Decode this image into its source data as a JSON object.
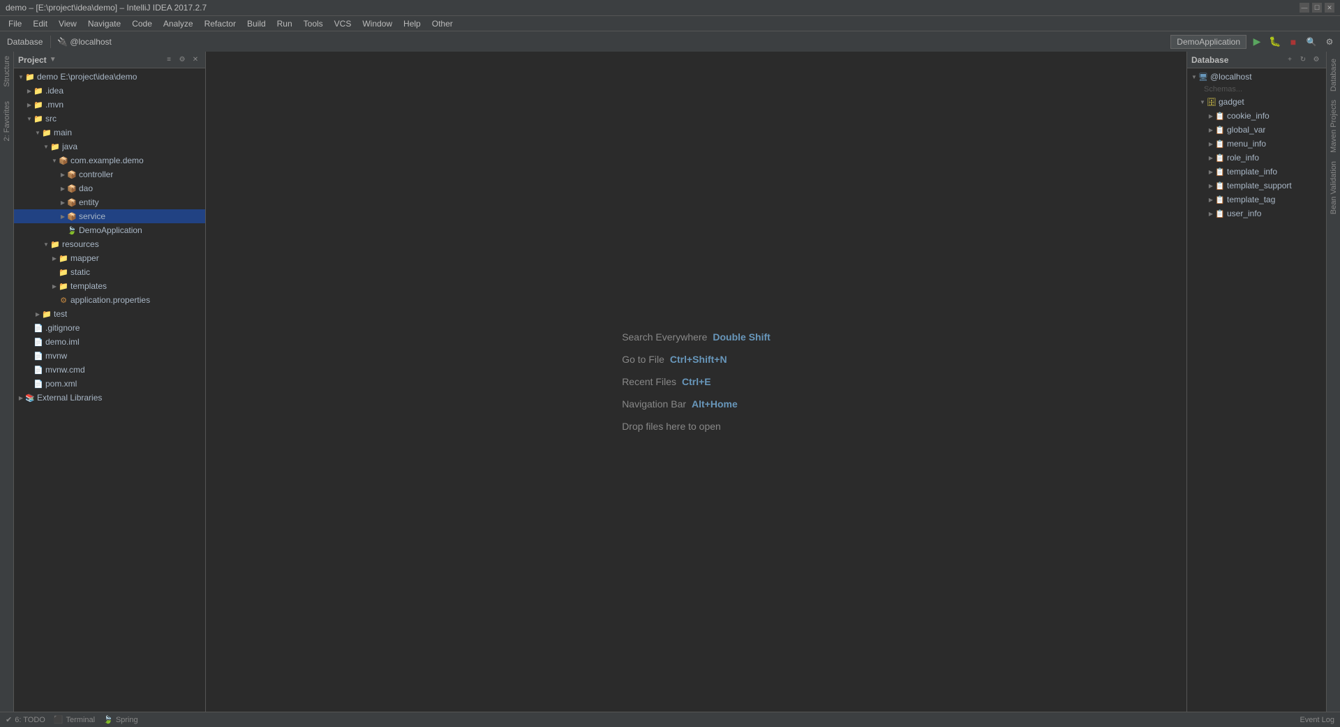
{
  "titleBar": {
    "title": "demo – [E:\\project\\idea\\demo] – IntelliJ IDEA 2017.2.7",
    "minimize": "—",
    "maximize": "☐",
    "close": "✕"
  },
  "menuBar": {
    "items": [
      "File",
      "Edit",
      "View",
      "Navigate",
      "Code",
      "Analyze",
      "Refactor",
      "Build",
      "Run",
      "Tools",
      "VCS",
      "Window",
      "Help",
      "Other"
    ]
  },
  "toolbar": {
    "dbLabel": "Database",
    "localhostLabel": "@localhost",
    "runConfig": "DemoApplication"
  },
  "projectPanel": {
    "title": "Project",
    "tree": [
      {
        "id": "demo",
        "label": "demo E:\\project\\idea\\demo",
        "indent": 1,
        "arrow": "▼",
        "iconType": "folder",
        "expanded": true
      },
      {
        "id": "idea",
        "label": ".idea",
        "indent": 2,
        "arrow": "▶",
        "iconType": "folder",
        "expanded": false
      },
      {
        "id": "mvn",
        "label": ".mvn",
        "indent": 2,
        "arrow": "▶",
        "iconType": "folder",
        "expanded": false
      },
      {
        "id": "src",
        "label": "src",
        "indent": 2,
        "arrow": "▼",
        "iconType": "folder-src",
        "expanded": true
      },
      {
        "id": "main",
        "label": "main",
        "indent": 3,
        "arrow": "▼",
        "iconType": "folder",
        "expanded": true
      },
      {
        "id": "java",
        "label": "java",
        "indent": 4,
        "arrow": "▼",
        "iconType": "folder-java",
        "expanded": true
      },
      {
        "id": "comexampledemo",
        "label": "com.example.demo",
        "indent": 5,
        "arrow": "▼",
        "iconType": "package",
        "expanded": true
      },
      {
        "id": "controller",
        "label": "controller",
        "indent": 6,
        "arrow": "▶",
        "iconType": "package",
        "expanded": false
      },
      {
        "id": "dao",
        "label": "dao",
        "indent": 6,
        "arrow": "▶",
        "iconType": "package",
        "expanded": false
      },
      {
        "id": "entity",
        "label": "entity",
        "indent": 6,
        "arrow": "▶",
        "iconType": "package",
        "expanded": false
      },
      {
        "id": "service",
        "label": "service",
        "indent": 6,
        "arrow": "▶",
        "iconType": "package",
        "expanded": false,
        "selected": true
      },
      {
        "id": "DemoApplication",
        "label": "DemoApplication",
        "indent": 6,
        "arrow": "",
        "iconType": "spring",
        "expanded": false
      },
      {
        "id": "resources",
        "label": "resources",
        "indent": 4,
        "arrow": "▼",
        "iconType": "folder",
        "expanded": true
      },
      {
        "id": "mapper",
        "label": "mapper",
        "indent": 5,
        "arrow": "▶",
        "iconType": "folder",
        "expanded": false
      },
      {
        "id": "static",
        "label": "static",
        "indent": 5,
        "arrow": "",
        "iconType": "folder",
        "expanded": false
      },
      {
        "id": "templates",
        "label": "templates",
        "indent": 5,
        "arrow": "▶",
        "iconType": "folder",
        "expanded": false
      },
      {
        "id": "appprops",
        "label": "application.properties",
        "indent": 5,
        "arrow": "",
        "iconType": "properties",
        "expanded": false
      },
      {
        "id": "test",
        "label": "test",
        "indent": 3,
        "arrow": "▶",
        "iconType": "folder",
        "expanded": false
      },
      {
        "id": "gitignore",
        "label": ".gitignore",
        "indent": 2,
        "arrow": "",
        "iconType": "git",
        "expanded": false
      },
      {
        "id": "demoiml",
        "label": "demo.iml",
        "indent": 2,
        "arrow": "",
        "iconType": "xml",
        "expanded": false
      },
      {
        "id": "mvnw",
        "label": "mvnw",
        "indent": 2,
        "arrow": "",
        "iconType": "file",
        "expanded": false
      },
      {
        "id": "mvnwcmd",
        "label": "mvnw.cmd",
        "indent": 2,
        "arrow": "",
        "iconType": "file",
        "expanded": false
      },
      {
        "id": "pomxml",
        "label": "pom.xml",
        "indent": 2,
        "arrow": "",
        "iconType": "xml",
        "expanded": false
      },
      {
        "id": "extlibs",
        "label": "External Libraries",
        "indent": 1,
        "arrow": "▶",
        "iconType": "lib",
        "expanded": false
      }
    ]
  },
  "centerArea": {
    "shortcuts": [
      {
        "label": "Search Everywhere",
        "key": "Double Shift"
      },
      {
        "label": "Go to File",
        "key": "Ctrl+Shift+N"
      },
      {
        "label": "Recent Files",
        "key": "Ctrl+E"
      },
      {
        "label": "Navigation Bar",
        "key": "Alt+Home"
      }
    ],
    "dropLabel": "Drop files here to open"
  },
  "databasePanel": {
    "title": "Database",
    "schemasLabel": "Schemas...",
    "tree": [
      {
        "id": "localhost",
        "label": "@localhost",
        "indent": 1,
        "arrow": "▼",
        "expanded": true
      },
      {
        "id": "gadget",
        "label": "gadget",
        "indent": 2,
        "arrow": "▼",
        "expanded": true
      },
      {
        "id": "cookie_info",
        "label": "cookie_info",
        "indent": 3,
        "arrow": "▶",
        "expanded": false
      },
      {
        "id": "global_var",
        "label": "global_var",
        "indent": 3,
        "arrow": "▶",
        "expanded": false
      },
      {
        "id": "menu_info",
        "label": "menu_info",
        "indent": 3,
        "arrow": "▶",
        "expanded": false
      },
      {
        "id": "role_info",
        "label": "role_info",
        "indent": 3,
        "arrow": "▶",
        "expanded": false
      },
      {
        "id": "template_info",
        "label": "template_info",
        "indent": 3,
        "arrow": "▶",
        "expanded": false
      },
      {
        "id": "template_support",
        "label": "template_support",
        "indent": 3,
        "arrow": "▶",
        "expanded": false
      },
      {
        "id": "template_tag",
        "label": "template_tag",
        "indent": 3,
        "arrow": "▶",
        "expanded": false
      },
      {
        "id": "user_info",
        "label": "user_info",
        "indent": 3,
        "arrow": "▶",
        "expanded": false
      }
    ]
  },
  "statusBar": {
    "todo": "6: TODO",
    "terminal": "Terminal",
    "spring": "Spring",
    "eventLog": "Event Log"
  },
  "sideTabs": {
    "right": [
      "Database",
      "Maven Projects",
      "Bean Validation"
    ],
    "left": [
      "Structure",
      "Favorites"
    ]
  },
  "colors": {
    "accent": "#6897bb",
    "selected": "#214283",
    "bg": "#2b2b2b",
    "panelBg": "#3c3f41",
    "green": "#5aa55f"
  }
}
